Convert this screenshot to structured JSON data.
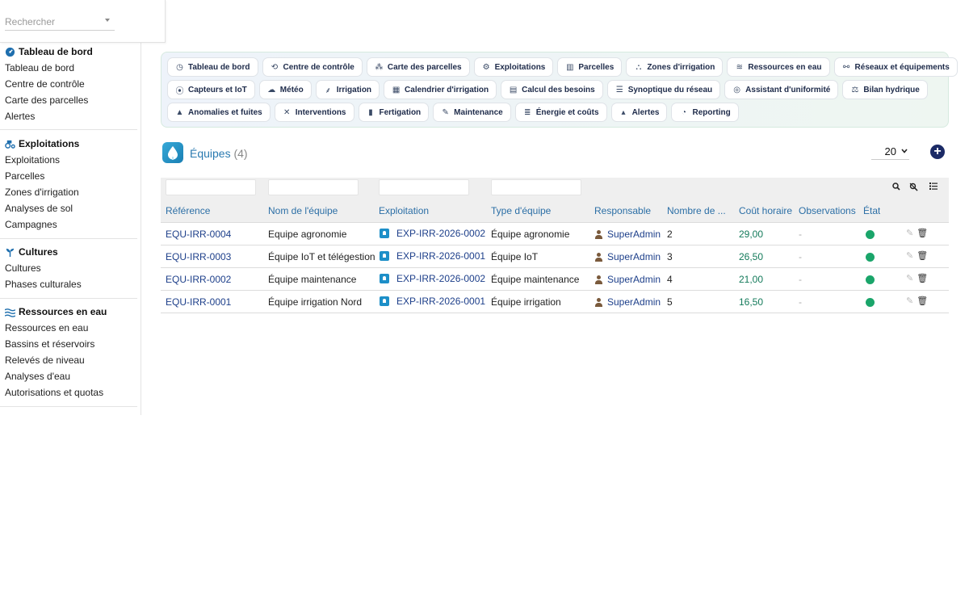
{
  "search": {
    "placeholder": "Rechercher"
  },
  "sidebar": {
    "sections": [
      {
        "title": "Tableau de bord",
        "icon": "gauge-icon",
        "items": [
          "Tableau de bord",
          "Centre de contrôle",
          "Carte des parcelles",
          "Alertes"
        ]
      },
      {
        "title": "Exploitations",
        "icon": "tractor-icon",
        "items": [
          "Exploitations",
          "Parcelles",
          "Zones d'irrigation",
          "Analyses de sol",
          "Campagnes"
        ]
      },
      {
        "title": "Cultures",
        "icon": "seedling-icon",
        "items": [
          "Cultures",
          "Phases culturales"
        ]
      },
      {
        "title": "Ressources en eau",
        "icon": "water-icon",
        "items": [
          "Ressources en eau",
          "Bassins et réservoirs",
          "Relevés de niveau",
          "Analyses d'eau",
          "Autorisations et quotas"
        ]
      }
    ]
  },
  "topnav": {
    "rows": [
      [
        {
          "label": "Tableau de bord",
          "icon": "gauge-icon",
          "glyph": "◷"
        },
        {
          "label": "Centre de contrôle",
          "icon": "satellite-icon",
          "glyph": "⟲"
        },
        {
          "label": "Carte des parcelles",
          "icon": "map-icon",
          "glyph": "⁂"
        },
        {
          "label": "Exploitations",
          "icon": "tractor-icon",
          "glyph": "⚙"
        },
        {
          "label": "Parcelles",
          "icon": "fields-icon",
          "glyph": "▥"
        },
        {
          "label": "Zones d'irrigation",
          "icon": "zones-icon",
          "glyph": "⛬"
        },
        {
          "label": "Ressources en eau",
          "icon": "water-icon",
          "glyph": "≋"
        },
        {
          "label": "Réseaux et équipements",
          "icon": "network-icon",
          "glyph": "⚯"
        }
      ],
      [
        {
          "label": "Capteurs et IoT",
          "icon": "sensor-icon",
          "glyph": "⦿"
        },
        {
          "label": "Météo",
          "icon": "weather-icon",
          "glyph": "☁"
        },
        {
          "label": "Irrigation",
          "icon": "sprinkler-icon",
          "glyph": "⸙"
        },
        {
          "label": "Calendrier d'irrigation",
          "icon": "calendar-icon",
          "glyph": "▦"
        },
        {
          "label": "Calcul des besoins",
          "icon": "calculator-icon",
          "glyph": "▤"
        },
        {
          "label": "Synoptique du réseau",
          "icon": "list-icon",
          "glyph": "☰"
        },
        {
          "label": "Assistant d'uniformité",
          "icon": "target-icon",
          "glyph": "◎"
        },
        {
          "label": "Bilan hydrique",
          "icon": "balance-icon",
          "glyph": "⚖"
        }
      ],
      [
        {
          "label": "Anomalies et fuites",
          "icon": "warning-icon",
          "glyph": "▲"
        },
        {
          "label": "Interventions",
          "icon": "tools-icon",
          "glyph": "✕"
        },
        {
          "label": "Fertigation",
          "icon": "bottle-icon",
          "glyph": "▮"
        },
        {
          "label": "Maintenance",
          "icon": "wrench-icon",
          "glyph": "✎"
        },
        {
          "label": "Énergie et coûts",
          "icon": "coins-icon",
          "glyph": "≣"
        },
        {
          "label": "Alertes",
          "icon": "bell-icon",
          "glyph": "▴"
        },
        {
          "label": "Reporting",
          "icon": "pie-icon",
          "glyph": "◔"
        }
      ]
    ]
  },
  "header": {
    "title": "Équipes",
    "count": "(4)"
  },
  "pager": {
    "page_size": "20"
  },
  "table": {
    "columns": [
      "Référence",
      "Nom de l'équipe",
      "Exploitation",
      "Type d'équipe",
      "Responsable",
      "Nombre de ...",
      "Coût horaire",
      "Observations",
      "État"
    ],
    "rows": [
      {
        "ref": "EQU-IRR-0004",
        "name": "Equipe agronomie",
        "exploitation": "EXP-IRR-2026-0002",
        "type": "Équipe agronomie",
        "responsable": "SuperAdmin",
        "nombre": "2",
        "cout": "29,00",
        "obs": "-"
      },
      {
        "ref": "EQU-IRR-0003",
        "name": "Équipe IoT et télégestion",
        "exploitation": "EXP-IRR-2026-0001",
        "type": "Équipe IoT",
        "responsable": "SuperAdmin",
        "nombre": "3",
        "cout": "26,50",
        "obs": "-"
      },
      {
        "ref": "EQU-IRR-0002",
        "name": "Équipe maintenance",
        "exploitation": "EXP-IRR-2026-0002",
        "type": "Équipe maintenance",
        "responsable": "SuperAdmin",
        "nombre": "4",
        "cout": "21,00",
        "obs": "-"
      },
      {
        "ref": "EQU-IRR-0001",
        "name": "Équipe irrigation Nord",
        "exploitation": "EXP-IRR-2026-0001",
        "type": "Équipe irrigation",
        "responsable": "SuperAdmin",
        "nombre": "5",
        "cout": "16,50",
        "obs": "-"
      }
    ]
  },
  "colors": {
    "accent": "#1b2a66",
    "link": "#1d3f8a",
    "status_active": "#1aa56a",
    "cost": "#137a5a"
  }
}
